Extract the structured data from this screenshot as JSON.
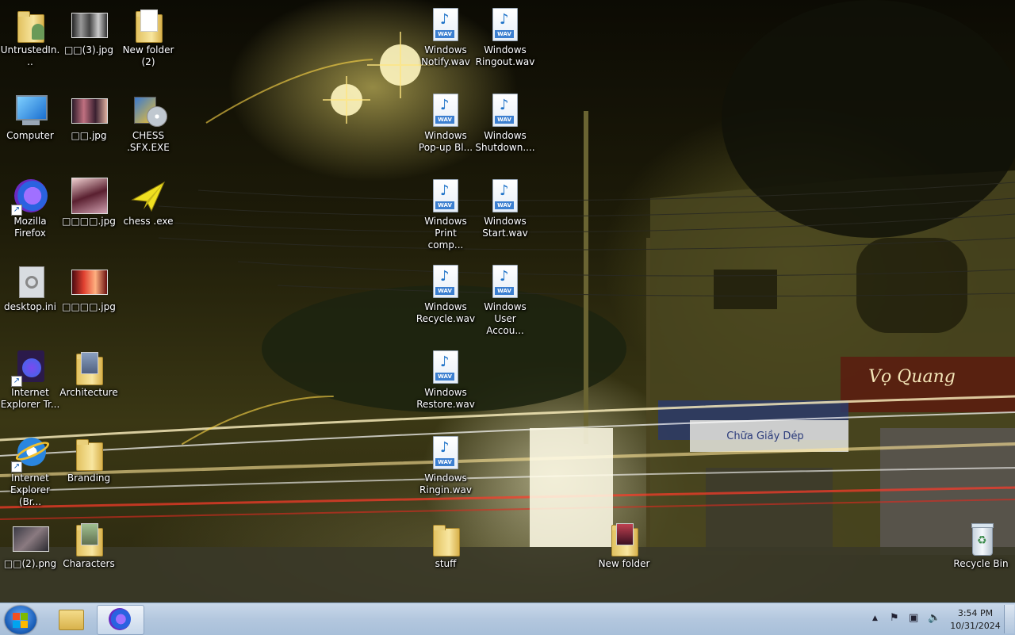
{
  "desktop": {
    "icons": {
      "untrusted": "UntrustedIn...",
      "img3": "□□(3).jpg",
      "newfolder2": "New folder\n(2)",
      "notify": "Windows\nNotify.wav",
      "ringout": "Windows\nRingout.wav",
      "computer": "Computer",
      "img": "□□.jpg",
      "chess_sfx": "CHESS\n.SFX.EXE",
      "popup": "Windows\nPop-up Bl...",
      "shutdown": "Windows\nShutdown....",
      "firefox": "Mozilla\nFirefox",
      "img4a": "□□□□.jpg",
      "chess_exe": "chess .exe",
      "print": "Windows\nPrint comp...",
      "start": "Windows\nStart.wav",
      "desktop_ini": "desktop.ini",
      "img4b": "□□□□.jpg",
      "recycle_wav": "Windows\nRecycle.wav",
      "user_acc": "Windows\nUser Accou...",
      "ie_tr": "Internet\nExplorer Tr...",
      "architecture": "Architecture",
      "restore": "Windows\nRestore.wav",
      "ie_br": "Internet\nExplorer (Br...",
      "branding": "Branding",
      "ringin": "Windows\nRingin.wav",
      "png2": "□□(2).png",
      "characters": "Characters",
      "stuff": "stuff",
      "newfolder": "New folder",
      "recycle_bin": "Recycle Bin"
    },
    "wallpaper_text": {
      "shop_sign": "Vọ Quang",
      "shop_sub": "Chữa Giầy Dép"
    }
  },
  "taskbar": {
    "clock_time": "3:54 PM",
    "clock_date": "10/31/2024"
  },
  "colors": {
    "taskbar": "#b3c7de",
    "start_orb": "#1b5fb8",
    "wav_blue": "#3c7fd0"
  }
}
